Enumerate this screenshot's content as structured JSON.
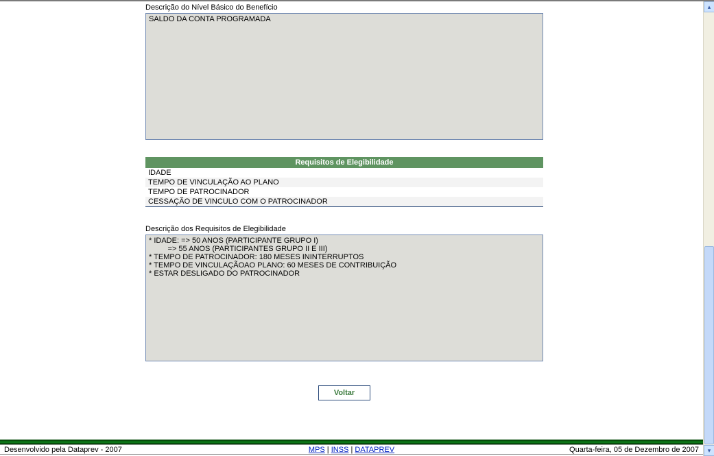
{
  "sections": {
    "basic_level_label": "Descrição do Nível Básico do Benefício",
    "basic_level_text": "SALDO DA CONTA PROGRAMADA",
    "eligibility_header": "Requisitos de Elegibilidade",
    "eligibility_rows": [
      "IDADE",
      "TEMPO DE VINCULAÇÃO AO PLANO",
      "TEMPO DE PATROCINADOR",
      "CESSAÇÃO DE VINCULO COM O PATROCINADOR"
    ],
    "eligibility_desc_label": "Descrição dos Requisitos de Elegibilidade",
    "eligibility_desc_text": "* IDADE: => 50 ANOS (PARTICIPANTE GRUPO I)\n         => 55 ANOS (PARTICIPANTES GRUPO II E III)\n* TEMPO DE PATROCINADOR: 180 MESES ININTERRUPTOS\n* TEMPO DE VINCULAÇÃOAO PLANO: 60 MESES DE CONTRIBUIÇÃO\n* ESTAR DESLIGADO DO PATROCINADOR"
  },
  "buttons": {
    "voltar": "Voltar"
  },
  "footer": {
    "left": "Desenvolvido pela Dataprev - 2007",
    "links": {
      "mps": "MPS",
      "inss": "INSS",
      "dataprev": "DATAPREV"
    },
    "sep": " | ",
    "right": "Quarta-feira, 05 de Dezembro de 2007"
  },
  "scrollbar": {
    "up_glyph": "▴",
    "down_glyph": "▾"
  }
}
